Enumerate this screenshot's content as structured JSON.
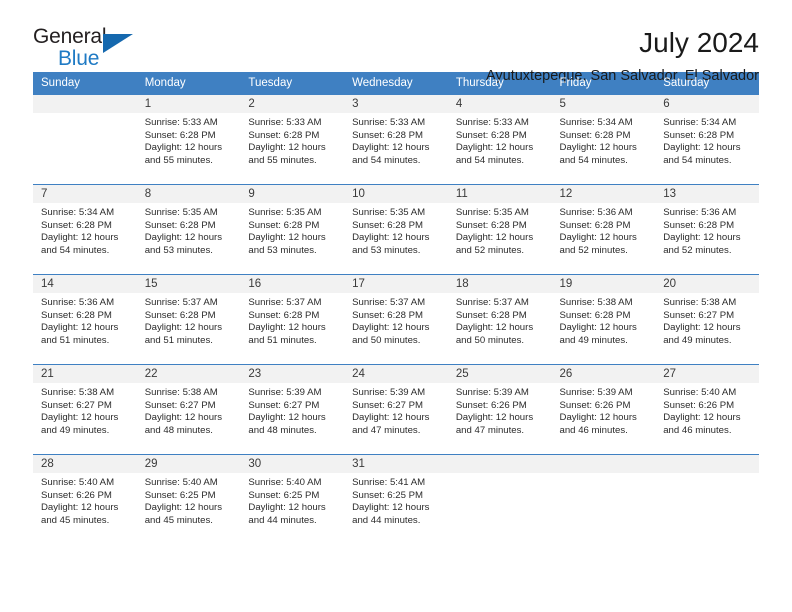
{
  "brand": {
    "name_part1": "General",
    "name_part2": "Blue"
  },
  "header": {
    "title": "July 2024",
    "subtitle": "Ayutuxtepeque, San Salvador, El Salvador"
  },
  "colors": {
    "header_blue": "#3f80c2",
    "logo_blue": "#1f7ac4",
    "daynum_band": "#f2f2f2"
  },
  "weekday_headers": [
    "Sunday",
    "Monday",
    "Tuesday",
    "Wednesday",
    "Thursday",
    "Friday",
    "Saturday"
  ],
  "weeks": [
    [
      {
        "day": ""
      },
      {
        "day": "1",
        "sunrise": "Sunrise: 5:33 AM",
        "sunset": "Sunset: 6:28 PM",
        "daylight1": "Daylight: 12 hours",
        "daylight2": "and 55 minutes."
      },
      {
        "day": "2",
        "sunrise": "Sunrise: 5:33 AM",
        "sunset": "Sunset: 6:28 PM",
        "daylight1": "Daylight: 12 hours",
        "daylight2": "and 55 minutes."
      },
      {
        "day": "3",
        "sunrise": "Sunrise: 5:33 AM",
        "sunset": "Sunset: 6:28 PM",
        "daylight1": "Daylight: 12 hours",
        "daylight2": "and 54 minutes."
      },
      {
        "day": "4",
        "sunrise": "Sunrise: 5:33 AM",
        "sunset": "Sunset: 6:28 PM",
        "daylight1": "Daylight: 12 hours",
        "daylight2": "and 54 minutes."
      },
      {
        "day": "5",
        "sunrise": "Sunrise: 5:34 AM",
        "sunset": "Sunset: 6:28 PM",
        "daylight1": "Daylight: 12 hours",
        "daylight2": "and 54 minutes."
      },
      {
        "day": "6",
        "sunrise": "Sunrise: 5:34 AM",
        "sunset": "Sunset: 6:28 PM",
        "daylight1": "Daylight: 12 hours",
        "daylight2": "and 54 minutes."
      }
    ],
    [
      {
        "day": "7",
        "sunrise": "Sunrise: 5:34 AM",
        "sunset": "Sunset: 6:28 PM",
        "daylight1": "Daylight: 12 hours",
        "daylight2": "and 54 minutes."
      },
      {
        "day": "8",
        "sunrise": "Sunrise: 5:35 AM",
        "sunset": "Sunset: 6:28 PM",
        "daylight1": "Daylight: 12 hours",
        "daylight2": "and 53 minutes."
      },
      {
        "day": "9",
        "sunrise": "Sunrise: 5:35 AM",
        "sunset": "Sunset: 6:28 PM",
        "daylight1": "Daylight: 12 hours",
        "daylight2": "and 53 minutes."
      },
      {
        "day": "10",
        "sunrise": "Sunrise: 5:35 AM",
        "sunset": "Sunset: 6:28 PM",
        "daylight1": "Daylight: 12 hours",
        "daylight2": "and 53 minutes."
      },
      {
        "day": "11",
        "sunrise": "Sunrise: 5:35 AM",
        "sunset": "Sunset: 6:28 PM",
        "daylight1": "Daylight: 12 hours",
        "daylight2": "and 52 minutes."
      },
      {
        "day": "12",
        "sunrise": "Sunrise: 5:36 AM",
        "sunset": "Sunset: 6:28 PM",
        "daylight1": "Daylight: 12 hours",
        "daylight2": "and 52 minutes."
      },
      {
        "day": "13",
        "sunrise": "Sunrise: 5:36 AM",
        "sunset": "Sunset: 6:28 PM",
        "daylight1": "Daylight: 12 hours",
        "daylight2": "and 52 minutes."
      }
    ],
    [
      {
        "day": "14",
        "sunrise": "Sunrise: 5:36 AM",
        "sunset": "Sunset: 6:28 PM",
        "daylight1": "Daylight: 12 hours",
        "daylight2": "and 51 minutes."
      },
      {
        "day": "15",
        "sunrise": "Sunrise: 5:37 AM",
        "sunset": "Sunset: 6:28 PM",
        "daylight1": "Daylight: 12 hours",
        "daylight2": "and 51 minutes."
      },
      {
        "day": "16",
        "sunrise": "Sunrise: 5:37 AM",
        "sunset": "Sunset: 6:28 PM",
        "daylight1": "Daylight: 12 hours",
        "daylight2": "and 51 minutes."
      },
      {
        "day": "17",
        "sunrise": "Sunrise: 5:37 AM",
        "sunset": "Sunset: 6:28 PM",
        "daylight1": "Daylight: 12 hours",
        "daylight2": "and 50 minutes."
      },
      {
        "day": "18",
        "sunrise": "Sunrise: 5:37 AM",
        "sunset": "Sunset: 6:28 PM",
        "daylight1": "Daylight: 12 hours",
        "daylight2": "and 50 minutes."
      },
      {
        "day": "19",
        "sunrise": "Sunrise: 5:38 AM",
        "sunset": "Sunset: 6:28 PM",
        "daylight1": "Daylight: 12 hours",
        "daylight2": "and 49 minutes."
      },
      {
        "day": "20",
        "sunrise": "Sunrise: 5:38 AM",
        "sunset": "Sunset: 6:27 PM",
        "daylight1": "Daylight: 12 hours",
        "daylight2": "and 49 minutes."
      }
    ],
    [
      {
        "day": "21",
        "sunrise": "Sunrise: 5:38 AM",
        "sunset": "Sunset: 6:27 PM",
        "daylight1": "Daylight: 12 hours",
        "daylight2": "and 49 minutes."
      },
      {
        "day": "22",
        "sunrise": "Sunrise: 5:38 AM",
        "sunset": "Sunset: 6:27 PM",
        "daylight1": "Daylight: 12 hours",
        "daylight2": "and 48 minutes."
      },
      {
        "day": "23",
        "sunrise": "Sunrise: 5:39 AM",
        "sunset": "Sunset: 6:27 PM",
        "daylight1": "Daylight: 12 hours",
        "daylight2": "and 48 minutes."
      },
      {
        "day": "24",
        "sunrise": "Sunrise: 5:39 AM",
        "sunset": "Sunset: 6:27 PM",
        "daylight1": "Daylight: 12 hours",
        "daylight2": "and 47 minutes."
      },
      {
        "day": "25",
        "sunrise": "Sunrise: 5:39 AM",
        "sunset": "Sunset: 6:26 PM",
        "daylight1": "Daylight: 12 hours",
        "daylight2": "and 47 minutes."
      },
      {
        "day": "26",
        "sunrise": "Sunrise: 5:39 AM",
        "sunset": "Sunset: 6:26 PM",
        "daylight1": "Daylight: 12 hours",
        "daylight2": "and 46 minutes."
      },
      {
        "day": "27",
        "sunrise": "Sunrise: 5:40 AM",
        "sunset": "Sunset: 6:26 PM",
        "daylight1": "Daylight: 12 hours",
        "daylight2": "and 46 minutes."
      }
    ],
    [
      {
        "day": "28",
        "sunrise": "Sunrise: 5:40 AM",
        "sunset": "Sunset: 6:26 PM",
        "daylight1": "Daylight: 12 hours",
        "daylight2": "and 45 minutes."
      },
      {
        "day": "29",
        "sunrise": "Sunrise: 5:40 AM",
        "sunset": "Sunset: 6:25 PM",
        "daylight1": "Daylight: 12 hours",
        "daylight2": "and 45 minutes."
      },
      {
        "day": "30",
        "sunrise": "Sunrise: 5:40 AM",
        "sunset": "Sunset: 6:25 PM",
        "daylight1": "Daylight: 12 hours",
        "daylight2": "and 44 minutes."
      },
      {
        "day": "31",
        "sunrise": "Sunrise: 5:41 AM",
        "sunset": "Sunset: 6:25 PM",
        "daylight1": "Daylight: 12 hours",
        "daylight2": "and 44 minutes."
      },
      {
        "day": ""
      },
      {
        "day": ""
      },
      {
        "day": ""
      }
    ]
  ]
}
